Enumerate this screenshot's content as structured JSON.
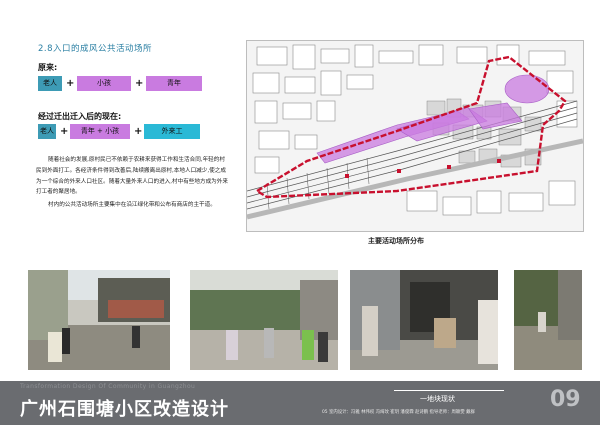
{
  "section_title": "2.8入口的成风公共活动场所",
  "origin": {
    "label": "原来:",
    "chips": [
      {
        "text": "老人",
        "color": "#3d9bb5"
      },
      {
        "text": "小孩",
        "color": "#c97be0"
      },
      {
        "text": "青年",
        "color": "#c97be0"
      }
    ]
  },
  "now": {
    "label": "经过迁出迁入后的现在:",
    "chips": [
      {
        "text": "老人",
        "color": "#3d9bb5"
      },
      {
        "text": "青年 + 小孩",
        "color": "#c97be0"
      },
      {
        "text": "外来工",
        "color": "#2ab9d6"
      }
    ]
  },
  "paragraphs": [
    "随着社会的发展,原村民已不依赖于农耕来获得工作和生活合同,年轻的村民到外面打工。各经济条件得到改善后,陆续搬离出原村,本地人口减少,使之成为一个综合的外来人口社区。随着大量外来人口的进入,村中有些地方成为外来打工者的聚居地。",
    "村内的公共活动场所主要集中在沿江绿化带和公布有商店的主干道。"
  ],
  "map_caption": "主要活动场所分布",
  "footer": {
    "title": "广州石围塘小区改造设计",
    "section": "一地块现状",
    "page_number": "09",
    "faded_text": "Transformation Design Of Community in Guangzhou",
    "credits": "05 室内设计：冯雅 林伟权 冯绮玟 崔玥 潘俊霖 赵诗鹏  指导老师：周颖雯 戴群"
  },
  "colors": {
    "title": "#2a7fa3",
    "boundary": "#c8102e",
    "activity": "#c97be0",
    "footer_bg": "#6a6c70",
    "footer_text": "#ffffff"
  }
}
